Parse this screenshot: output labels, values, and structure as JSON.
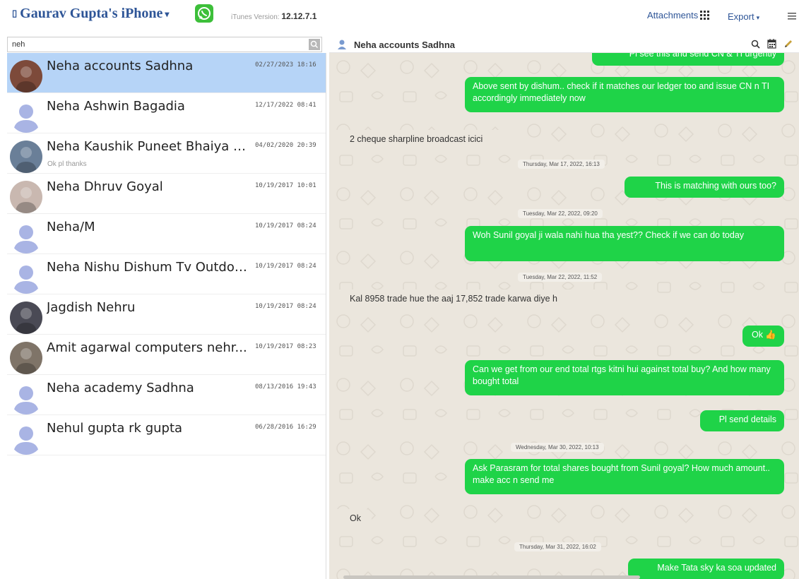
{
  "topbar": {
    "device_icon": "apple-icon",
    "device_name": " Gaurav Gupta's iPhone",
    "itunes_label": "iTunes Version:",
    "itunes_version": "12.12.7.1",
    "attachments_label": "Attachments",
    "export_label": "Export"
  },
  "search": {
    "value": "neh"
  },
  "contacts": [
    {
      "name": "Neha accounts Sadhna",
      "date": "02/27/2023 18:16",
      "preview": ""
    },
    {
      "name": "Neha Ashwin Bagadia",
      "date": "12/17/2022 08:41",
      "preview": ""
    },
    {
      "name": "Neha Kaushik Puneet Bhaiya S...",
      "date": "04/02/2020 20:39",
      "preview": "Ok pl thanks"
    },
    {
      "name": "Neha Dhruv Goyal",
      "date": "10/19/2017 10:01",
      "preview": ""
    },
    {
      "name": "Neha/M",
      "date": "10/19/2017 08:24",
      "preview": ""
    },
    {
      "name": "Neha Nishu Dishum Tv Outdoo...",
      "date": "10/19/2017 08:24",
      "preview": ""
    },
    {
      "name": "Jagdish Nehru",
      "date": "10/19/2017 08:24",
      "preview": ""
    },
    {
      "name": "Amit agarwal computers nehr...",
      "date": "10/19/2017 08:23",
      "preview": ""
    },
    {
      "name": "Neha academy Sadhna",
      "date": "08/13/2016 19:43",
      "preview": ""
    },
    {
      "name": "Nehul gupta rk gupta",
      "date": "06/28/2016 16:29",
      "preview": ""
    }
  ],
  "chat": {
    "title": "Neha accounts Sadhna",
    "messages": [
      {
        "kind": "out",
        "text": "Pl see this and send CN & TI urgently"
      },
      {
        "kind": "out",
        "text": "Above sent by dishum.. check if it matches our ledger too and issue CN n TI accordingly immediately now"
      },
      {
        "kind": "in",
        "text": "2 cheque sharpline broadcast icici"
      },
      {
        "kind": "sep",
        "text": "Thursday, Mar 17, 2022, 16:13"
      },
      {
        "kind": "out",
        "text": "This is matching with ours too?"
      },
      {
        "kind": "sep",
        "text": "Tuesday, Mar 22, 2022, 09:20"
      },
      {
        "kind": "out",
        "text": "Woh Sunil goyal ji wala nahi hua tha yest?? Check if we can do today"
      },
      {
        "kind": "sep",
        "text": "Tuesday, Mar 22, 2022, 11:52"
      },
      {
        "kind": "in",
        "text": "Kal 8958 trade hue the aaj 17,852 trade karwa diye h"
      },
      {
        "kind": "out",
        "text": "Ok 👍"
      },
      {
        "kind": "out",
        "text": "Can we get from our end total rtgs kitni hui against total buy? And how many bought total"
      },
      {
        "kind": "out",
        "text": "Pl send details"
      },
      {
        "kind": "sep",
        "text": "Wednesday, Mar 30, 2022, 10:13"
      },
      {
        "kind": "out",
        "text": "Ask Parasram for total shares bought from Sunil goyal? How much amount.. make acc n send me"
      },
      {
        "kind": "in",
        "text": "Ok"
      },
      {
        "kind": "sep",
        "text": "Thursday, Mar 31, 2022, 16:02"
      },
      {
        "kind": "out",
        "text": "Make Tata sky ka soa updated"
      }
    ]
  },
  "colors": {
    "brand_blue": "#2e5597",
    "outgoing_bubble": "#1fd348",
    "selected_row": "#b6d4f7",
    "chat_background": "#ebe6dd"
  }
}
